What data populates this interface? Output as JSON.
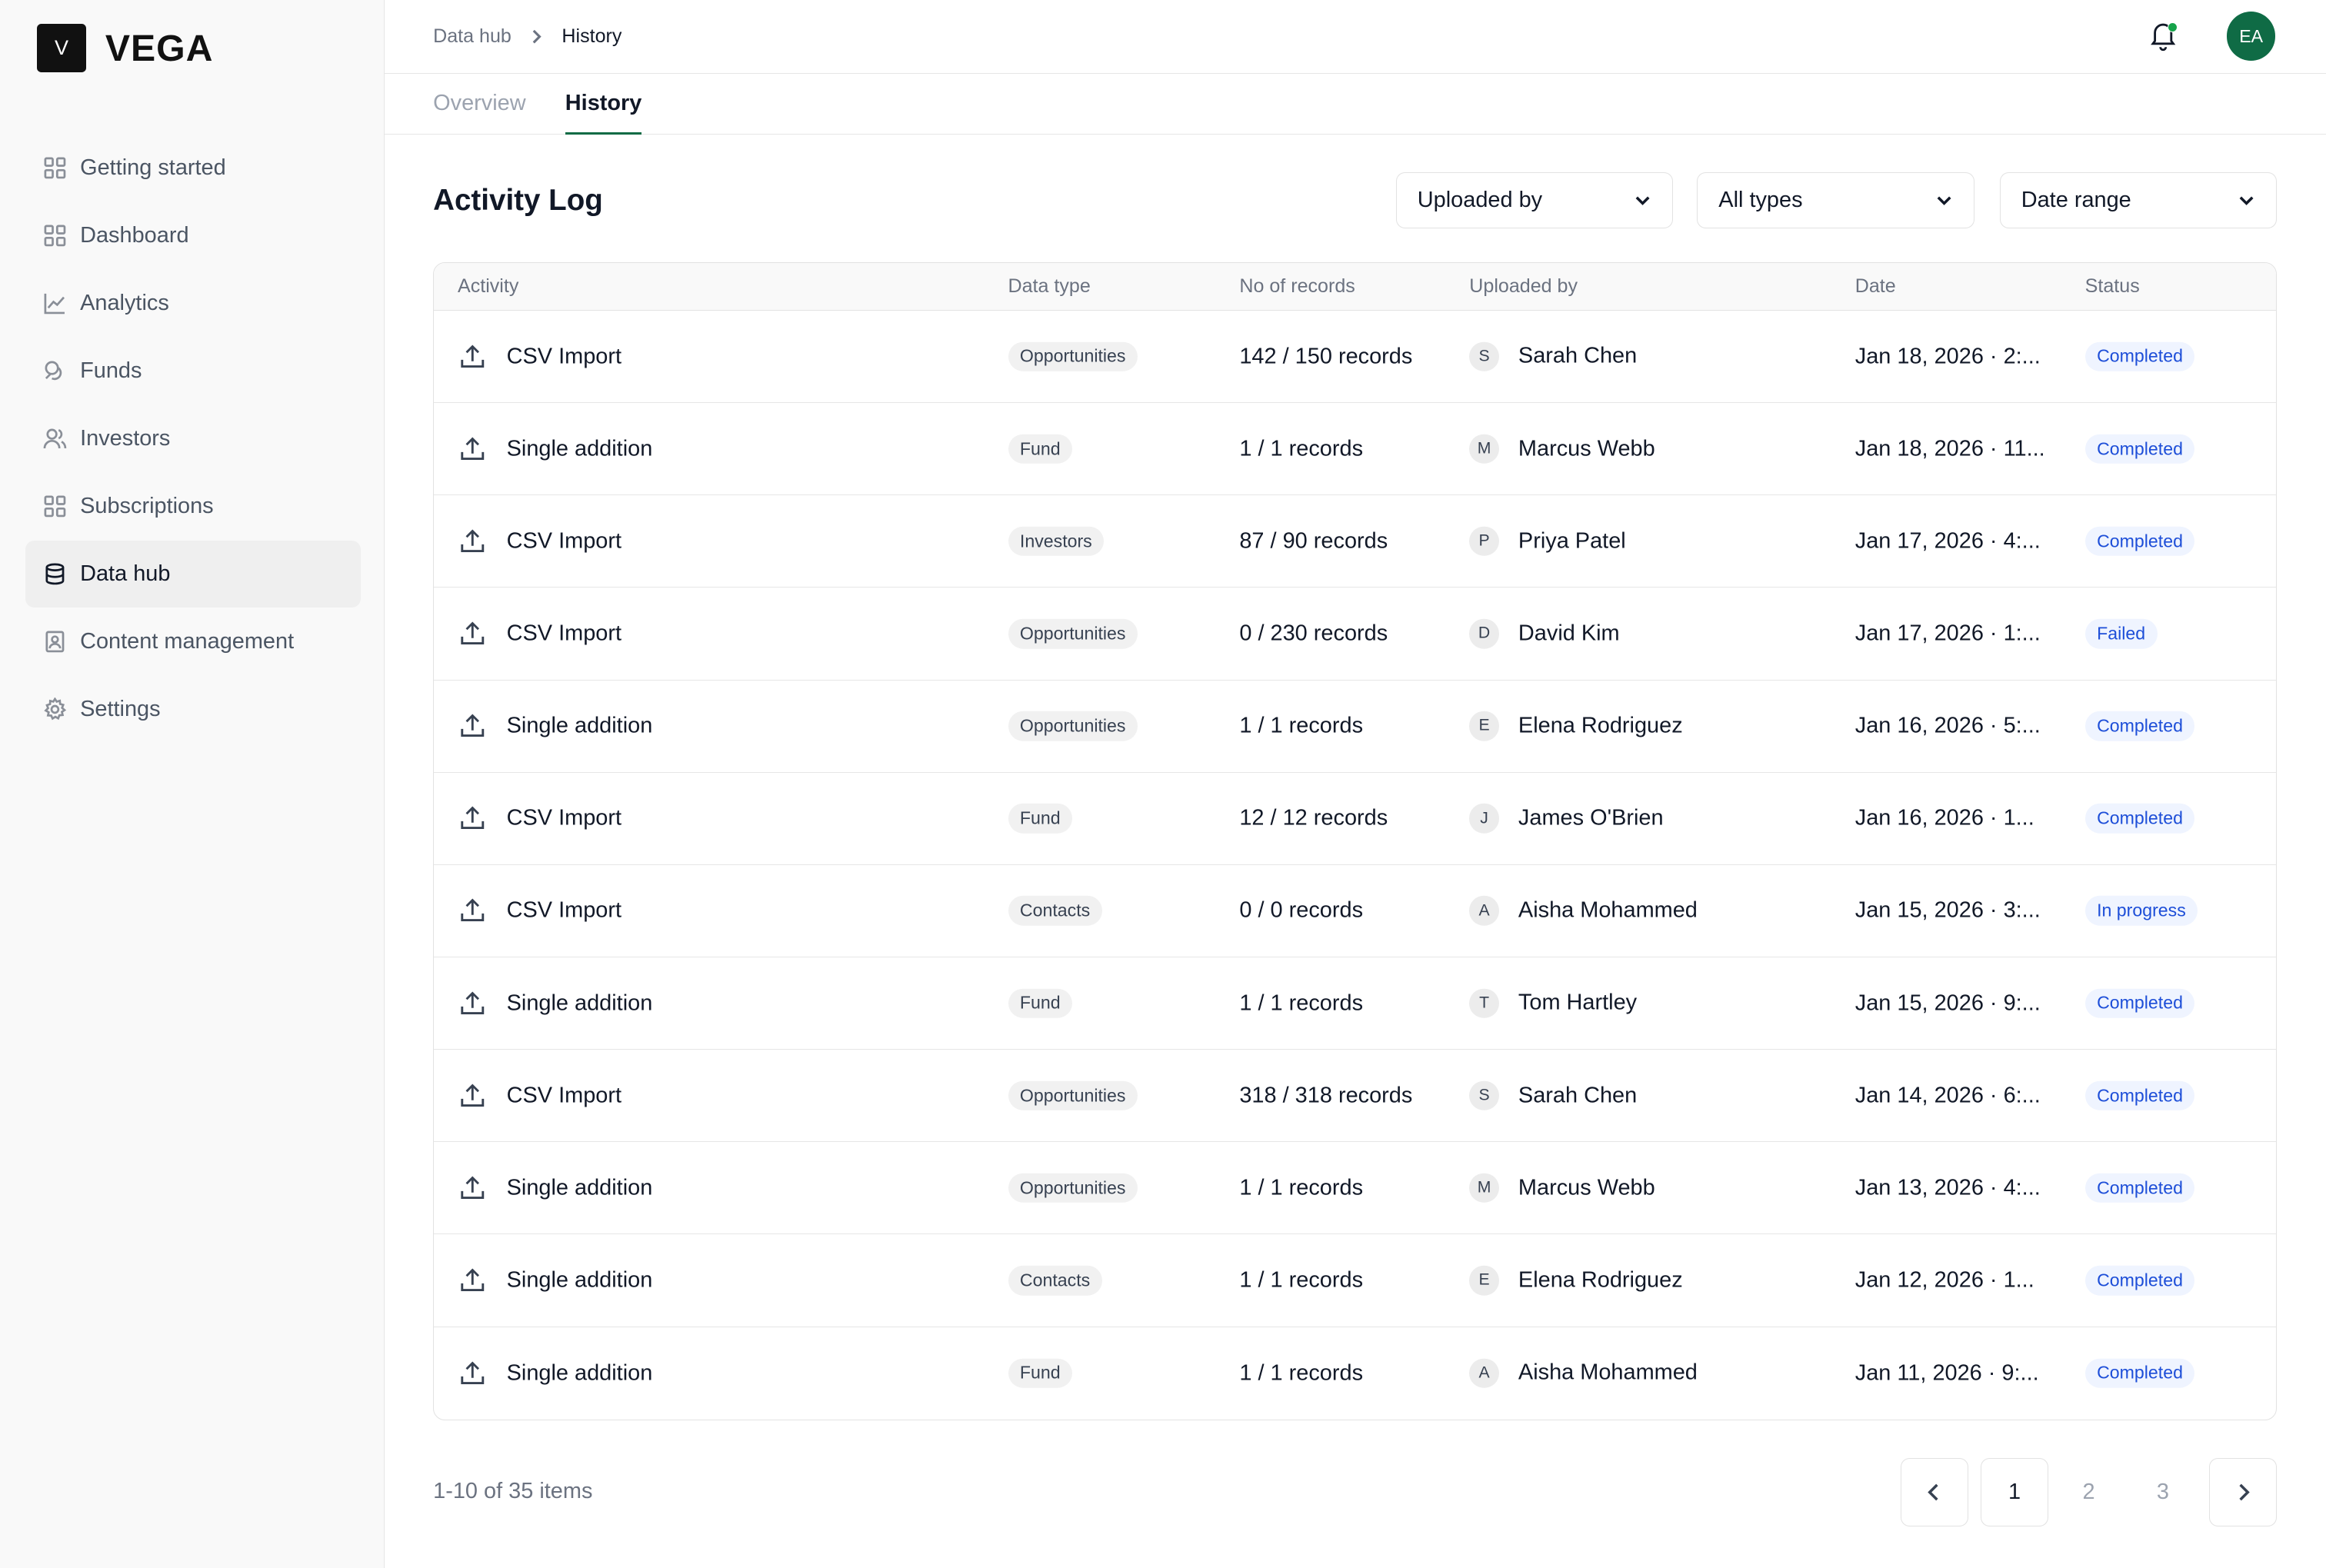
{
  "brand": {
    "mark": "V",
    "name": "VEGA"
  },
  "sidebar": {
    "items": [
      {
        "label": "Getting started",
        "icon": "grid-icon"
      },
      {
        "label": "Dashboard",
        "icon": "grid-icon"
      },
      {
        "label": "Analytics",
        "icon": "line-chart-icon"
      },
      {
        "label": "Funds",
        "icon": "coins-icon"
      },
      {
        "label": "Investors",
        "icon": "users-icon"
      },
      {
        "label": "Subscriptions",
        "icon": "grid-icon"
      },
      {
        "label": "Data hub",
        "icon": "database-icon",
        "active": true
      },
      {
        "label": "Content management",
        "icon": "document-icon"
      },
      {
        "label": "Settings",
        "icon": "gear-icon"
      }
    ]
  },
  "header": {
    "breadcrumb": [
      "Data hub",
      "History"
    ],
    "avatar_initials": "EA",
    "notification_dot_color": "#16a34a",
    "avatar_color": "#0f6b45"
  },
  "tabs": [
    {
      "label": "Overview",
      "active": false
    },
    {
      "label": "History",
      "active": true
    }
  ],
  "page": {
    "title": "Activity Log",
    "filters": [
      "Uploaded by",
      "All types",
      "Date range"
    ]
  },
  "table": {
    "columns": [
      "Activity",
      "Data type",
      "No of records",
      "Uploaded by",
      "Date",
      "Status"
    ],
    "rows": [
      {
        "activity": "CSV Import",
        "type": "Opportunities",
        "records": "142 / 150 records",
        "initial": "S",
        "user": "Sarah Chen",
        "date": "Jan 18, 2026 · 2:...",
        "status": "Completed"
      },
      {
        "activity": "Single addition",
        "type": "Fund",
        "records": "1 / 1 records",
        "initial": "M",
        "user": "Marcus Webb",
        "date": "Jan 18, 2026 · 11...",
        "status": "Completed"
      },
      {
        "activity": "CSV Import",
        "type": "Investors",
        "records": "87 / 90 records",
        "initial": "P",
        "user": "Priya Patel",
        "date": "Jan 17, 2026 · 4:...",
        "status": "Completed"
      },
      {
        "activity": "CSV Import",
        "type": "Opportunities",
        "records": "0 / 230 records",
        "initial": "D",
        "user": "David Kim",
        "date": "Jan 17, 2026 · 1:...",
        "status": "Failed"
      },
      {
        "activity": "Single addition",
        "type": "Opportunities",
        "records": "1 / 1 records",
        "initial": "E",
        "user": "Elena Rodriguez",
        "date": "Jan 16, 2026 · 5:...",
        "status": "Completed"
      },
      {
        "activity": "CSV Import",
        "type": "Fund",
        "records": "12 / 12 records",
        "initial": "J",
        "user": "James O'Brien",
        "date": "Jan 16, 2026 · 1...",
        "status": "Completed"
      },
      {
        "activity": "CSV Import",
        "type": "Contacts",
        "records": "0 / 0 records",
        "initial": "A",
        "user": "Aisha Mohammed",
        "date": "Jan 15, 2026 · 3:...",
        "status": "In progress"
      },
      {
        "activity": "Single addition",
        "type": "Fund",
        "records": "1 / 1 records",
        "initial": "T",
        "user": "Tom Hartley",
        "date": "Jan 15, 2026 · 9:...",
        "status": "Completed"
      },
      {
        "activity": "CSV Import",
        "type": "Opportunities",
        "records": "318 / 318 records",
        "initial": "S",
        "user": "Sarah Chen",
        "date": "Jan 14, 2026 · 6:...",
        "status": "Completed"
      },
      {
        "activity": "Single addition",
        "type": "Opportunities",
        "records": "1 / 1 records",
        "initial": "M",
        "user": "Marcus Webb",
        "date": "Jan 13, 2026 · 4:...",
        "status": "Completed"
      },
      {
        "activity": "Single addition",
        "type": "Contacts",
        "records": "1 / 1 records",
        "initial": "E",
        "user": "Elena Rodriguez",
        "date": "Jan 12, 2026 · 1...",
        "status": "Completed"
      },
      {
        "activity": "Single addition",
        "type": "Fund",
        "records": "1 / 1 records",
        "initial": "A",
        "user": "Aisha Mohammed",
        "date": "Jan 11, 2026 · 9:...",
        "status": "Completed"
      }
    ]
  },
  "status_colors": {
    "Completed": {
      "fg": "#1d4ed8",
      "bg": "#eff4ff"
    },
    "Failed": {
      "fg": "#1d4ed8",
      "bg": "#eff4ff"
    },
    "In progress": {
      "fg": "#1d4ed8",
      "bg": "#eff4ff"
    }
  },
  "pagination": {
    "summary": "1-10 of 35 items",
    "pages": [
      "1",
      "2",
      "3"
    ],
    "current": "1"
  }
}
